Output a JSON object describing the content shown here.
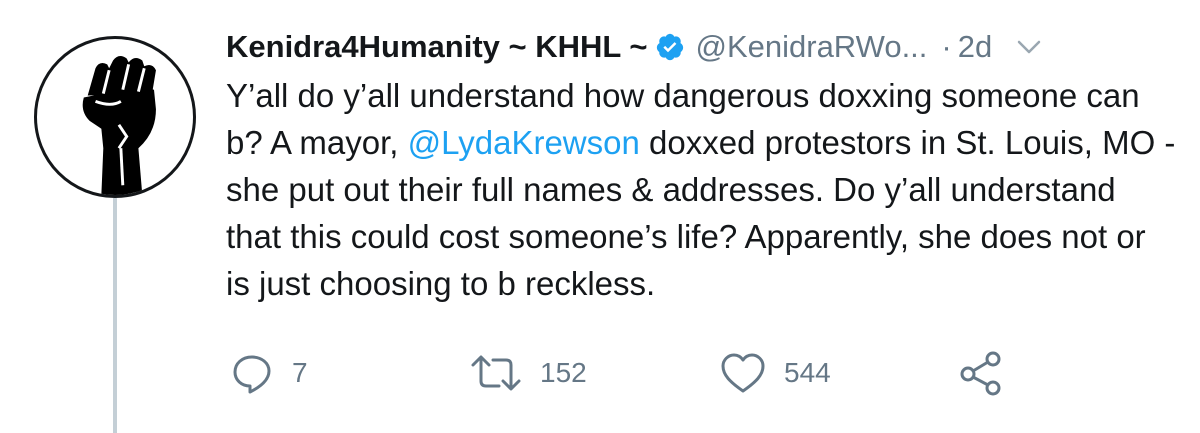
{
  "tweet": {
    "display_name": "Kenidra4Humanity ~ KHHL ~",
    "handle": "@KenidraRWo...",
    "separator": "·",
    "time": "2d",
    "text_part1": "Y’all do y’all understand how dangerous doxxing someone can b? A mayor, ",
    "mention": "@LydaKrewson",
    "text_part2": " doxxed protestors in St. Louis, MO - she put out their full names & addresses. Do y’all understand that this could cost someone’s life? Apparently, she does not or is just choosing to b reckless.",
    "avatar_icon": "raised-fist-icon",
    "verified_icon": "verified-badge-icon",
    "colors": {
      "link": "#1da1f2",
      "secondary": "#657786",
      "text": "#14171a",
      "thread_line": "#c4cfd6"
    }
  },
  "actions": {
    "reply": {
      "icon": "reply-icon",
      "count": "7"
    },
    "retweet": {
      "icon": "retweet-icon",
      "count": "152"
    },
    "like": {
      "icon": "heart-icon",
      "count": "544"
    },
    "share": {
      "icon": "share-icon"
    }
  }
}
